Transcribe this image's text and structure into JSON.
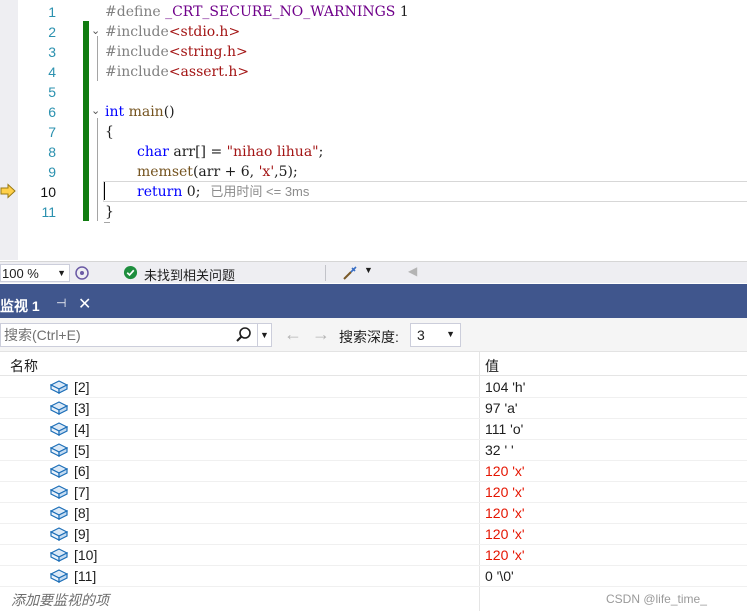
{
  "editor": {
    "lines": [
      {
        "num": "1",
        "code": "#define _CRT_SECURE_NO_WARNINGS 1"
      },
      {
        "num": "2",
        "code": "#include<stdio.h>"
      },
      {
        "num": "3",
        "code": "#include<string.h>"
      },
      {
        "num": "4",
        "code": "#include<assert.h>"
      },
      {
        "num": "5",
        "code": ""
      },
      {
        "num": "6",
        "code": "int main()"
      },
      {
        "num": "7",
        "code": "{"
      },
      {
        "num": "8",
        "code": "char arr[] = \"nihao lihua\";"
      },
      {
        "num": "9",
        "code": "memset(arr + 6, 'x',5);"
      },
      {
        "num": "10",
        "code": "return 0;"
      },
      {
        "num": "11",
        "code": "}"
      }
    ],
    "tokens": {
      "define_kw": "#define",
      "define_name": "_CRT_SECURE_NO_WARNINGS",
      "define_val": "1",
      "include_kw": "#include",
      "inc_stdio": "<stdio.h>",
      "inc_string": "<string.h>",
      "inc_assert": "<assert.h>",
      "int_kw": "int",
      "main_fn": "main",
      "main_parens": "()",
      "open_brace": "{",
      "char_kw": "char",
      "arr_decl": " arr[] = ",
      "str_literal": "\"nihao lihua\"",
      "semicolon": ";",
      "memset_fn": "memset",
      "memset_args_a": "(arr + 6, ",
      "memset_char": "'x'",
      "memset_args_b": ",5);",
      "return_kw": "return",
      "return_val": " 0;",
      "close_brace": "}"
    },
    "elapsed_hint": "已用时间 <= 3ms",
    "active_line": "10"
  },
  "statusbar": {
    "zoom": "100 %",
    "issues_text": "未找到相关问题"
  },
  "watch": {
    "tab_title": "监视 1",
    "pin_glyph": "⊣",
    "close_glyph": "✕",
    "search_placeholder": "搜索(Ctrl+E)",
    "depth_label": "搜索深度:",
    "depth_value": "3",
    "columns": {
      "name": "名称",
      "value": "值"
    },
    "rows": [
      {
        "name": "[2]",
        "value": "104 'h'",
        "changed": false
      },
      {
        "name": "[3]",
        "value": "97 'a'",
        "changed": false
      },
      {
        "name": "[4]",
        "value": "111 'o'",
        "changed": false
      },
      {
        "name": "[5]",
        "value": "32 ' '",
        "changed": false
      },
      {
        "name": "[6]",
        "value": "120 'x'",
        "changed": true
      },
      {
        "name": "[7]",
        "value": "120 'x'",
        "changed": true
      },
      {
        "name": "[8]",
        "value": "120 'x'",
        "changed": true
      },
      {
        "name": "[9]",
        "value": "120 'x'",
        "changed": true
      },
      {
        "name": "[10]",
        "value": "120 'x'",
        "changed": true
      },
      {
        "name": "[11]",
        "value": "0 '\\0'",
        "changed": false
      }
    ],
    "add_watch": "添加要监视的项",
    "watermark": "CSDN @life_time_"
  },
  "colors": {
    "changed_value": "#e51400",
    "tab_background": "#40568d",
    "change_bar": "#107c10"
  }
}
